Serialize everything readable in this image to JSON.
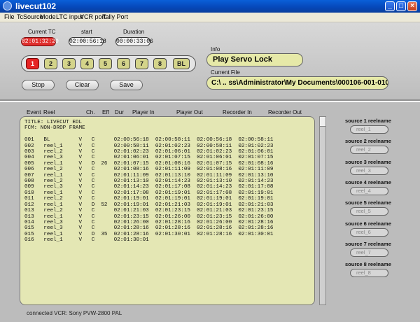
{
  "window": {
    "title": "livecut102",
    "min": "_",
    "max": "□",
    "close": "×"
  },
  "menu": [
    "File",
    "TcSource",
    "Mode",
    "LTC input",
    "VCR port",
    "Tally Port"
  ],
  "timecodes": {
    "current_label": "Current TC",
    "current": "02:01:32:20",
    "start_label": "start",
    "start": "02:00:56:18",
    "duration_label": "Duration",
    "duration": "00:00:33:06"
  },
  "reels": [
    "1",
    "2",
    "3",
    "4",
    "5",
    "6",
    "7",
    "8",
    "BL"
  ],
  "actions": {
    "stop": "Stop",
    "clear": "Clear",
    "save": "Save"
  },
  "info": {
    "label": "Info",
    "value": "Play Servo Lock"
  },
  "file": {
    "label": "Current File",
    "value": "C:\\ .. ss\\Administrator\\My Documents\\000106-001-010307.EDL"
  },
  "columns": [
    "Event",
    "Reel",
    "Ch.",
    "Eff",
    "Dur",
    "Player In",
    "Player Out",
    "Recorder In",
    "Recorder Out"
  ],
  "edl": {
    "title": "TITLE: LIVECUT EDL",
    "fcm": "FCM: NON-DROP FRAME",
    "rows": [
      [
        "001",
        "BL",
        "V",
        "C",
        "",
        "02:00:56:18",
        "02:00:58:11",
        "02:00:56:18",
        "02:00:58:11"
      ],
      [
        "002",
        "reel_1",
        "V",
        "C",
        "",
        "02:00:58:11",
        "02:01:02:23",
        "02:00:58:11",
        "02:01:02:23"
      ],
      [
        "003",
        "reel_2",
        "V",
        "C",
        "",
        "02:01:02:23",
        "02:01:06:01",
        "02:01:02:23",
        "02:01:06:01"
      ],
      [
        "004",
        "reel_3",
        "V",
        "C",
        "",
        "02:01:06:01",
        "02:01:07:15",
        "02:01:06:01",
        "02:01:07:15"
      ],
      [
        "005",
        "reel_1",
        "V",
        "D",
        "26",
        "02:01:07:15",
        "02:01:08:16",
        "02:01:07:15",
        "02:01:08:16"
      ],
      [
        "006",
        "reel_2",
        "V",
        "C",
        "",
        "02:01:08:16",
        "02:01:11:09",
        "02:01:08:16",
        "02:01:11:09"
      ],
      [
        "007",
        "reel_1",
        "V",
        "C",
        "",
        "02:01:11:09",
        "02:01:13:10",
        "02:01:11:09",
        "02:01:13:10"
      ],
      [
        "008",
        "reel_2",
        "V",
        "C",
        "",
        "02:01:13:10",
        "02:01:14:23",
        "02:01:13:10",
        "02:01:14:23"
      ],
      [
        "009",
        "reel_3",
        "V",
        "C",
        "",
        "02:01:14:23",
        "02:01:17:08",
        "02:01:14:23",
        "02:01:17:08"
      ],
      [
        "010",
        "reel_1",
        "V",
        "C",
        "",
        "02:01:17:08",
        "02:01:19:01",
        "02:01:17:08",
        "02:01:19:01"
      ],
      [
        "011",
        "reel_2",
        "V",
        "C",
        "",
        "02:01:19:01",
        "02:01:19:01",
        "02:01:19:01",
        "02:01:19:01"
      ],
      [
        "012",
        "reel_1",
        "V",
        "D",
        "52",
        "02:01:19:01",
        "02:01:21:03",
        "02:01:19:01",
        "02:01:21:03"
      ],
      [
        "013",
        "reel_2",
        "V",
        "C",
        "",
        "02:01:21:03",
        "02:01:23:15",
        "02:01:21:03",
        "02:01:23:15"
      ],
      [
        "013",
        "reel_1",
        "V",
        "C",
        "",
        "02:01:23:15",
        "02:01:26:00",
        "02:01:23:15",
        "02:01:26:00"
      ],
      [
        "014",
        "reel_3",
        "V",
        "C",
        "",
        "02:01:26:00",
        "02:01:28:16",
        "02:01:26:00",
        "02:01:28:16"
      ],
      [
        "015",
        "reel_3",
        "V",
        "C",
        "",
        "02:01:28:16",
        "02:01:28:16",
        "02:01:28:16",
        "02:01:28:16"
      ],
      [
        "015",
        "reel_1",
        "V",
        "D",
        "35",
        "02:01:28:16",
        "02:01:30:01",
        "02:01:28:16",
        "02:01:30:01"
      ],
      [
        "016",
        "reel_1",
        "V",
        "C",
        "",
        "02:01:30:01",
        "",
        "",
        ""
      ]
    ]
  },
  "sources": [
    {
      "label": "source 1 reelname",
      "value": "reel_1"
    },
    {
      "label": "source 2 reelname",
      "value": "reel_2"
    },
    {
      "label": "source 3 reelname",
      "value": "reel_3"
    },
    {
      "label": "source 4 reelname",
      "value": "reel_4"
    },
    {
      "label": "source 5 reelname",
      "value": "reel_5"
    },
    {
      "label": "source 6 reelname",
      "value": "reel_6"
    },
    {
      "label": "source 7 reelname",
      "value": "reel_7"
    },
    {
      "label": "source 8 reelname",
      "value": "reel_8"
    }
  ],
  "status": "connected VCR: Sony PVW-2800 PAL"
}
